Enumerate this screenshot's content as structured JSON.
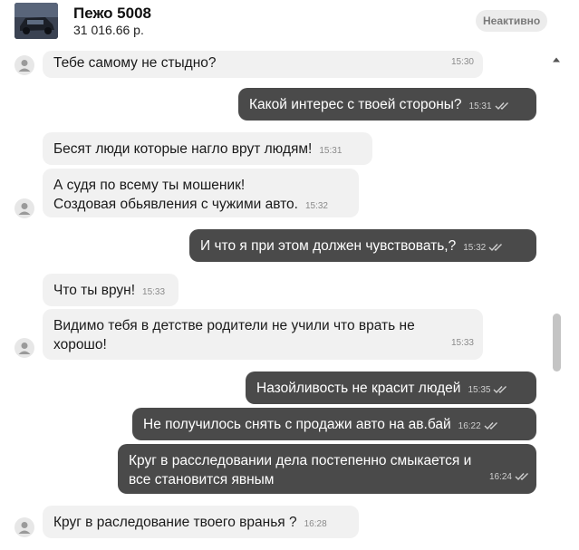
{
  "listing": {
    "title": "Пежо 5008",
    "price": "31 016.66 р.",
    "status": "Неактивно"
  },
  "messages": [
    {
      "dir": "in",
      "lines": [
        "Тебе самому не стыдно?"
      ],
      "time": "15:30"
    },
    {
      "dir": "out",
      "lines": [
        "Какой интерес с твоей стороны?"
      ],
      "time": "15:31"
    },
    {
      "dir": "in",
      "lines": [
        "Бесят люди которые нагло врут людям!"
      ],
      "time": "15:31"
    },
    {
      "dir": "in",
      "lines": [
        "А судя по всему ты мошеник!",
        "Создовая обьявления с чужими авто."
      ],
      "time": "15:32"
    },
    {
      "dir": "out",
      "lines": [
        "И что я при этом должен чувствовать,?"
      ],
      "time": "15:32"
    },
    {
      "dir": "in",
      "lines": [
        "Что ты врун!"
      ],
      "time": "15:33"
    },
    {
      "dir": "in",
      "lines": [
        "Видимо тебя в детстве родители не учили что врать не",
        "хорошо!"
      ],
      "time": "15:33"
    },
    {
      "dir": "out",
      "lines": [
        "Назойливость не красит людей"
      ],
      "time": "15:35"
    },
    {
      "dir": "out",
      "lines": [
        "Не получилось снять с продажи авто на ав.бай"
      ],
      "time": "16:22"
    },
    {
      "dir": "out",
      "lines": [
        "Круг в расследовании дела постепенно смыкается и",
        "все становится явным"
      ],
      "time": "16:24"
    },
    {
      "dir": "in",
      "lines": [
        "Круг в раследование твоего вранья ?"
      ],
      "time": "16:28"
    }
  ]
}
